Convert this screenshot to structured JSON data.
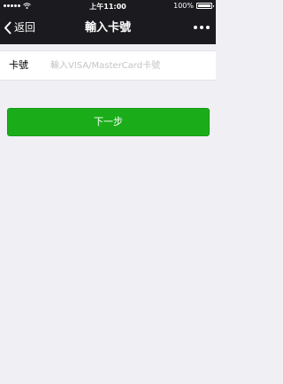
{
  "status_bar": {
    "time": "上午11:00",
    "battery": "100%",
    "battery_level": 1.0
  },
  "nav": {
    "back_label": "返回",
    "title": "輸入卡號",
    "icons": {
      "back": "chevron-left-icon",
      "more": "more-icon"
    }
  },
  "card_field": {
    "label": "卡號",
    "placeholder": "輸入VISA/MasterCard卡號",
    "value": ""
  },
  "next_button": {
    "label": "下一步"
  },
  "colors": {
    "nav_background": "#1B1B1F",
    "page_background": "#EFEFF4",
    "button_green": "#1AAD19",
    "placeholder_gray": "#C4C4C8"
  }
}
